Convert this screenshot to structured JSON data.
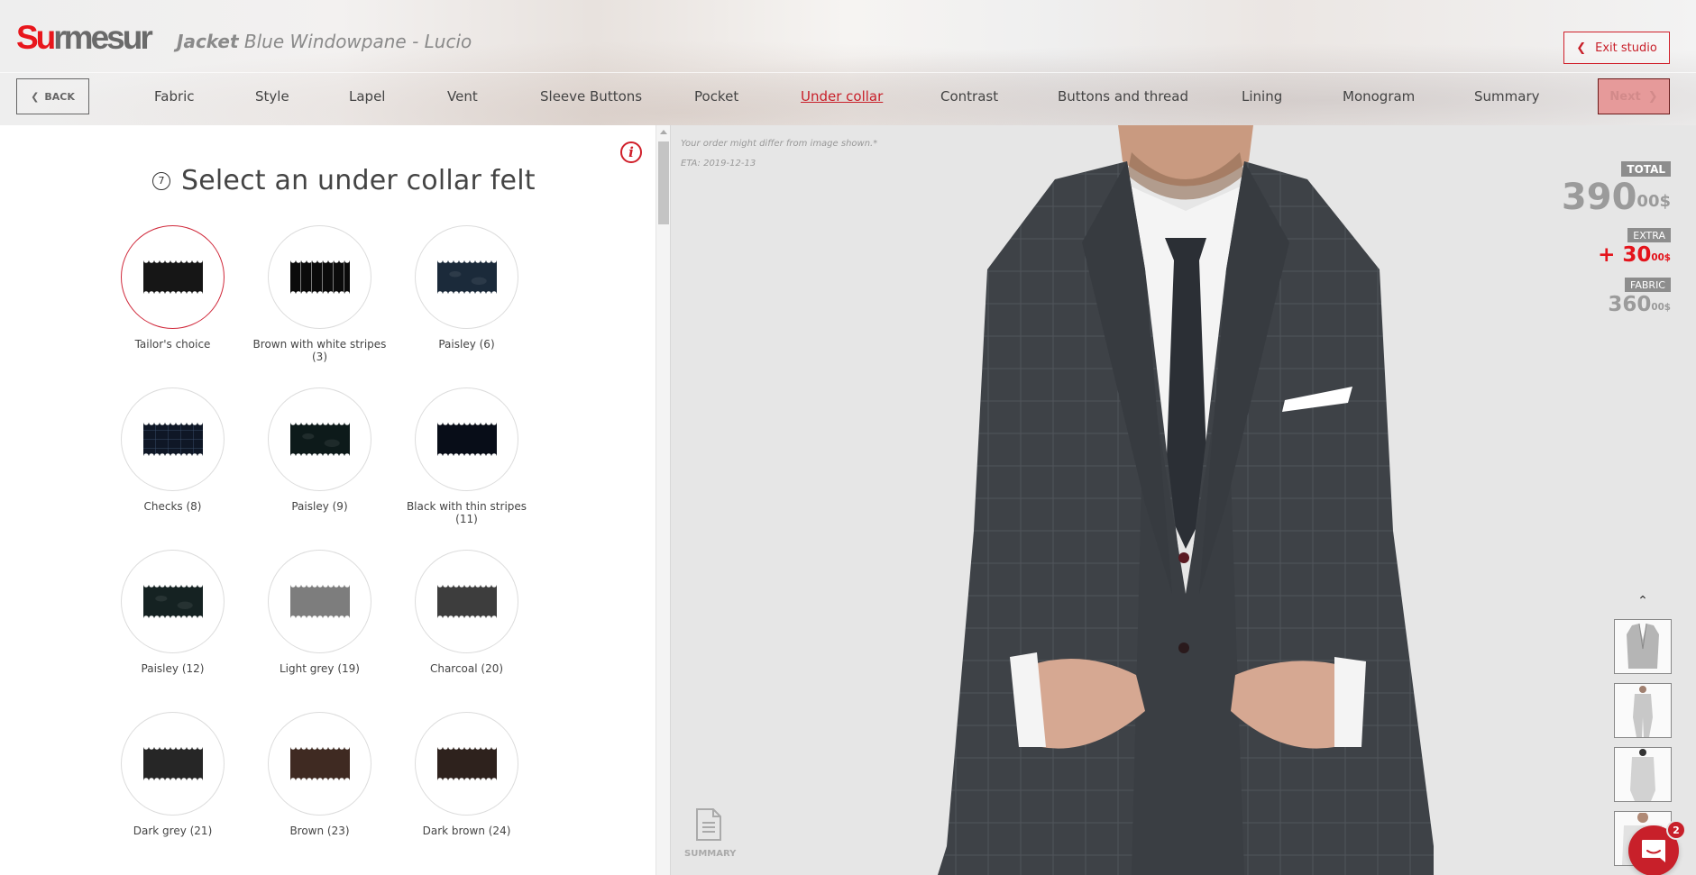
{
  "header": {
    "logo_su": "Su",
    "logo_mesur": "rmesur",
    "product_type": "Jacket",
    "product_name": "Blue Windowpane - Lucio",
    "exit_label": "Exit studio"
  },
  "nav": {
    "back_label": "BACK",
    "items": [
      {
        "label": "Fabric"
      },
      {
        "label": "Style"
      },
      {
        "label": "Lapel"
      },
      {
        "label": "Vent"
      },
      {
        "label": "Sleeve Buttons"
      },
      {
        "label": "Pocket"
      },
      {
        "label": "Under collar",
        "active": true
      },
      {
        "label": "Contrast"
      },
      {
        "label": "Buttons and thread"
      },
      {
        "label": "Lining"
      },
      {
        "label": "Monogram"
      },
      {
        "label": "Summary"
      }
    ],
    "next_label": "Next"
  },
  "step": {
    "number": "7",
    "title": "Select an under collar felt"
  },
  "options": [
    {
      "label": "Tailor's choice",
      "color": "#161616",
      "pattern": "plain",
      "selected": true
    },
    {
      "label": "Brown with white stripes (3)",
      "color": "#0b0b0b",
      "pattern": "stripes"
    },
    {
      "label": "Paisley (6)",
      "color": "#1b2a3a",
      "pattern": "paisley"
    },
    {
      "label": "Checks (8)",
      "color": "#0f1726",
      "pattern": "checks"
    },
    {
      "label": "Paisley (9)",
      "color": "#0d1a1a",
      "pattern": "paisley"
    },
    {
      "label": "Black with thin stripes (11)",
      "color": "#080d18",
      "pattern": "plain"
    },
    {
      "label": "Paisley (12)",
      "color": "#152222",
      "pattern": "paisley"
    },
    {
      "label": "Light grey (19)",
      "color": "#7d7d7d",
      "pattern": "plain"
    },
    {
      "label": "Charcoal (20)",
      "color": "#3d3d3d",
      "pattern": "plain"
    },
    {
      "label": "Dark grey (21)",
      "color": "#262626",
      "pattern": "plain"
    },
    {
      "label": "Brown (23)",
      "color": "#3f2a22",
      "pattern": "plain"
    },
    {
      "label": "Dark brown (24)",
      "color": "#2e221d",
      "pattern": "plain"
    }
  ],
  "preview": {
    "disclaimer": "Your order might differ from image shown.*",
    "eta": "ETA: 2019-12-13",
    "summary_label": "SUMMARY"
  },
  "pricing": {
    "total_label": "TOTAL",
    "total_int": "390",
    "total_cents": "00$",
    "extra_label": "EXTRA",
    "extra_int": "+ 30",
    "extra_cents": "00$",
    "fabric_label": "FABRIC",
    "fabric_int": "360",
    "fabric_cents": "00$"
  },
  "thumbnails": [
    {
      "view": "jacket-front"
    },
    {
      "view": "model-front"
    },
    {
      "view": "model-back"
    },
    {
      "view": "model-closeup"
    }
  ],
  "chat": {
    "badge_count": "2"
  },
  "colors": {
    "accent": "#c8202a",
    "extra_red": "#e4141c",
    "next_bg": "#e69a9a",
    "price_grey": "#9b9b9b"
  }
}
